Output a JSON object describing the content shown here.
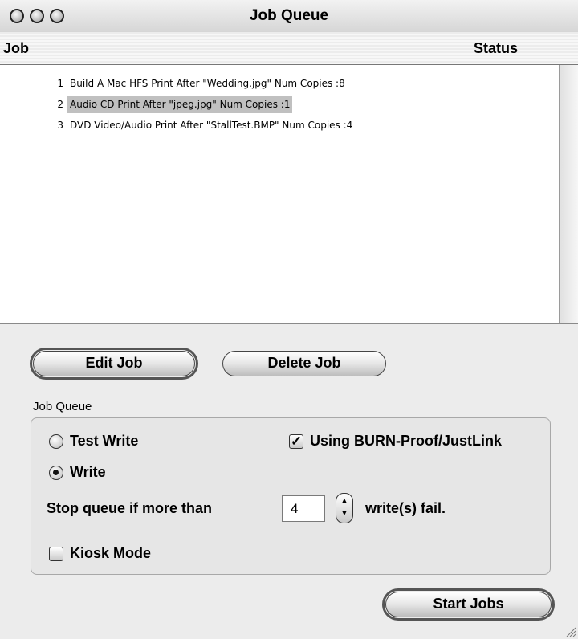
{
  "window": {
    "title": "Job Queue"
  },
  "columns": {
    "job": "Job",
    "status": "Status"
  },
  "jobs": [
    {
      "index": "1",
      "text": "Build A Mac HFS Print After \"Wedding.jpg\"  Num Copies :8",
      "selected": false
    },
    {
      "index": "2",
      "text": "Audio CD Print After \"jpeg.jpg\"  Num Copies :1",
      "selected": true
    },
    {
      "index": "3",
      "text": "DVD Video/Audio Print After \"StallTest.BMP\"  Num Copies :4",
      "selected": false
    }
  ],
  "buttons": {
    "edit": "Edit Job",
    "delete": "Delete Job",
    "start": "Start Jobs"
  },
  "options": {
    "group_label": "Job Queue",
    "test_write": "Test Write",
    "write": "Write",
    "write_mode_selected": "Write",
    "burn_proof": "Using BURN-Proof/JustLink",
    "burn_proof_checked": true,
    "stop_prefix": "Stop queue if more than",
    "stop_value": "4",
    "stop_suffix": "write(s) fail.",
    "kiosk": "Kiosk Mode",
    "kiosk_checked": false
  }
}
